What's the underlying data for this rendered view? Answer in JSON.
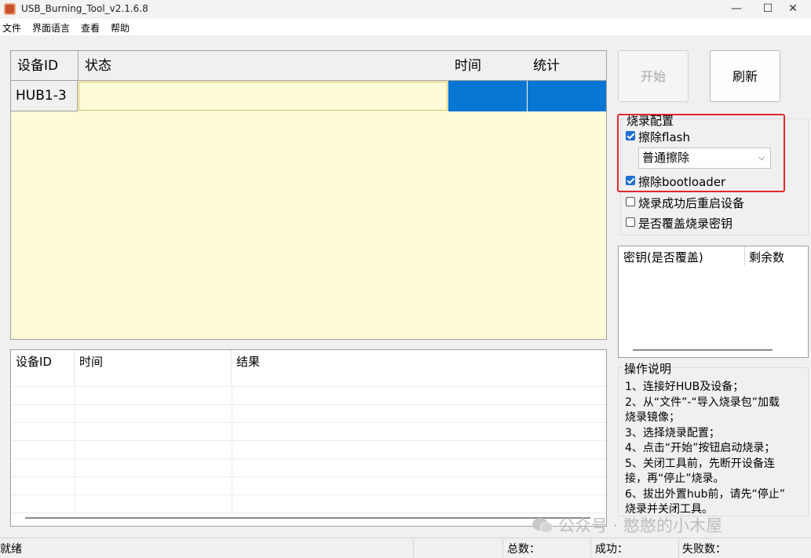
{
  "window": {
    "title": "USB_Burning_Tool_v2.1.6.8",
    "minimize": "—",
    "maximize": "☐",
    "close": "✕"
  },
  "menu": [
    "文件",
    "界面语言",
    "查看",
    "帮助"
  ],
  "device_grid": {
    "columns": [
      "设备ID",
      "状态",
      "时间",
      "统计"
    ],
    "rows": [
      {
        "id": "HUB1-3",
        "status": "",
        "time": "",
        "stat": ""
      }
    ]
  },
  "log_grid": {
    "columns": [
      "设备ID",
      "时间",
      "结果"
    ]
  },
  "buttons": {
    "start": "开始",
    "refresh": "刷新"
  },
  "burn_config": {
    "title": "烧录配置",
    "erase_flash": {
      "label": "擦除flash",
      "checked": true
    },
    "erase_mode": "普通擦除",
    "erase_bootloader": {
      "label": "擦除bootloader",
      "checked": true
    },
    "reboot_after": {
      "label": "烧录成功后重启设备",
      "checked": false
    },
    "overwrite_key": {
      "label": "是否覆盖烧录密钥",
      "checked": false
    }
  },
  "key_list": {
    "columns": [
      "密钥(是否覆盖)",
      "剩余数"
    ]
  },
  "instructions": {
    "title": "操作说明",
    "lines": [
      "1、连接好HUB及设备；",
      "2、从“文件”-“导入烧录包”加载",
      "烧录镜像；",
      "3、选择烧录配置；",
      "4、点击“开始”按钮启动烧录；",
      "5、关闭工具前，先断开设备连",
      "接，再“停止”烧录。",
      "6、拔出外置hub前，请先“停止”",
      "烧录并关闭工具。"
    ]
  },
  "watermark": "公众号 · 憨憨的小木屋",
  "status_bar": {
    "state": "就绪",
    "total": "总数：",
    "success": "成功：",
    "failed": "失败数："
  },
  "colors": {
    "accent_blue": "#0a76d4",
    "highlight_red": "#e0282e",
    "grid_bg": "#fdfbd8"
  }
}
